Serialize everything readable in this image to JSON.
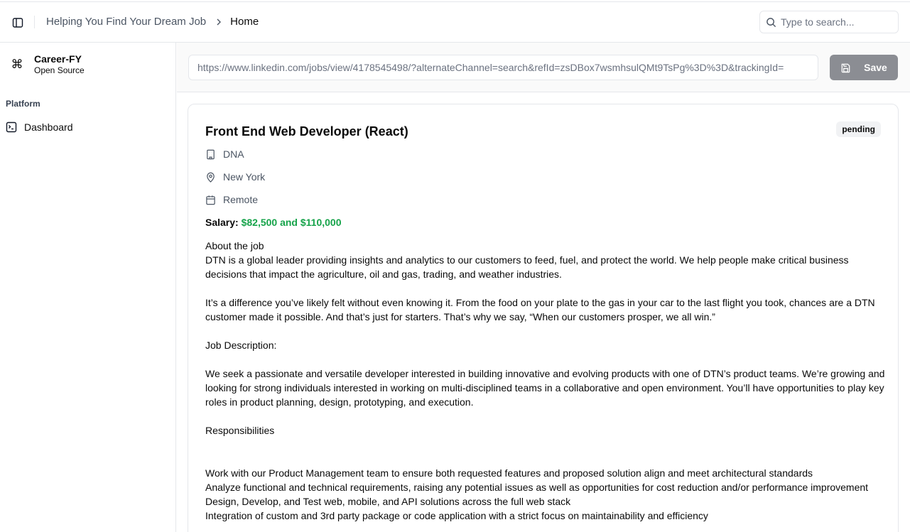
{
  "header": {
    "breadcrumb": {
      "link": "Helping You Find Your Dream Job",
      "current": "Home"
    },
    "search": {
      "placeholder": "Type to search..."
    }
  },
  "sidebar": {
    "brand": {
      "title": "Career-FY",
      "subtitle": "Open Source",
      "icon": "command-icon"
    },
    "section_label": "Platform",
    "items": [
      {
        "label": "Dashboard",
        "icon": "terminal-square-icon"
      }
    ]
  },
  "toolbar": {
    "url_value": "https://www.linkedin.com/jobs/view/4178545498/?alternateChannel=search&refId=zsDBox7wsmhsulQMt9TsPg%3D%3D&trackingId=",
    "save_label": "Save"
  },
  "job": {
    "title": "Front End Web Developer (React)",
    "status": "pending",
    "company": "DNA",
    "location": "New York",
    "work_type": "Remote",
    "salary_label": "Salary:",
    "salary_value": "$82,500 and $110,000",
    "description": {
      "about_heading": "About the job",
      "about_1": "DTN is a global leader providing insights and analytics to our customers to feed, fuel, and protect the world. We help people make critical business decisions that impact the agriculture, oil and gas, trading, and weather industries.",
      "about_2": "It’s a difference you’ve likely felt without even knowing it. From the food on your plate to the gas in your car to the last flight you took, chances are a DTN customer made it possible. And that’s just for starters. That’s why we say, “When our customers prosper, we all win.”",
      "job_desc_heading": "Job Description:",
      "job_desc": "We seek a passionate and versatile developer interested in building innovative and evolving products with one of DTN’s product teams. We’re growing and looking for strong individuals interested in working on multi-disciplined teams in a collaborative and open environment. You’ll have opportunities to play key roles in product planning, design, prototyping, and execution.",
      "responsibilities_heading": "Responsibilities",
      "responsibilities": [
        "Work with our Product Management team to ensure both requested features and proposed solution align and meet architectural standards",
        "Analyze functional and technical requirements, raising any potential issues as well as opportunities for cost reduction and/or performance improvement",
        "Design, Develop, and Test web, mobile, and API solutions across the full web stack",
        "Integration of custom and 3rd party package or code application with a strict focus on maintainability and efficiency"
      ]
    }
  }
}
